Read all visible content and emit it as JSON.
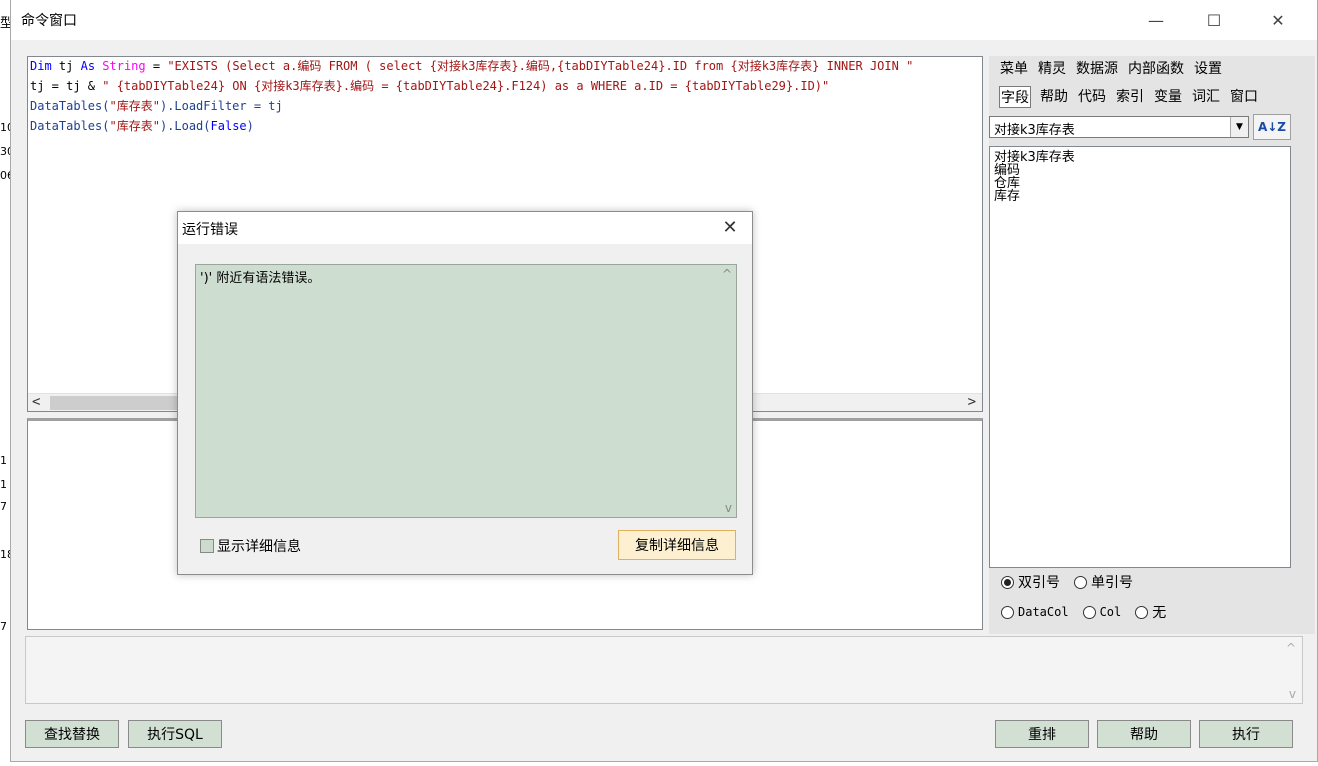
{
  "background": {
    "numbers": [
      "10",
      "30",
      "06",
      "1",
      "1",
      "7",
      "18",
      "7"
    ],
    "title_fragment": "型"
  },
  "window": {
    "title": "命令窗口",
    "minimize": "—",
    "maximize": "☐",
    "close": "✕"
  },
  "editor": {
    "line1": {
      "kw1": "Dim",
      "var1": " tj ",
      "kw2": "As",
      "sp": " ",
      "type": "String",
      "eq": " = ",
      "str": "\"EXISTS (Select a.编码 FROM ( select {对接k3库存表}.编码,{tabDIYTable24}.ID from {对接k3库存表} INNER JOIN \""
    },
    "line2": {
      "pre": "tj = tj & ",
      "str": "\" {tabDIYTable24} ON {对接k3库存表}.编码 = {tabDIYTable24}.F124) as a WHERE a.ID = {tabDIYTable29}.ID)\""
    },
    "line3": {
      "fn": "DataTables(",
      "str": "\"库存表\"",
      "post": ").LoadFilter = tj"
    },
    "line4": {
      "fn": "DataTables(",
      "str": "\"库存表\"",
      "post": ").Load(",
      "kw": "False",
      "end": ")"
    },
    "scroll_left": "<",
    "scroll_right": ">"
  },
  "right_panel": {
    "menu_row1": [
      "菜单",
      "精灵",
      "数据源",
      "内部函数",
      "设置"
    ],
    "menu_row2": [
      "字段",
      "帮助",
      "代码",
      "索引",
      "变量",
      "词汇",
      "窗口"
    ],
    "active_tab": "字段",
    "combo_value": "对接k3库存表",
    "combo_arrow": "▼",
    "sort_icon": "A↓Z",
    "fields": [
      "对接k3库存表",
      "编码",
      "仓库",
      "库存"
    ],
    "radio_row1": [
      {
        "label": "双引号",
        "checked": true
      },
      {
        "label": "单引号",
        "checked": false
      }
    ],
    "radio_row2": [
      {
        "label": "DataCol",
        "checked": false
      },
      {
        "label": "Col",
        "checked": false
      },
      {
        "label": "无",
        "checked": false
      }
    ]
  },
  "bottom": {
    "scroll_up": "^",
    "scroll_down": "v",
    "buttons_left": [
      "查找替换",
      "执行SQL"
    ],
    "buttons_right": [
      "重排",
      "帮助",
      "执行"
    ]
  },
  "dialog": {
    "title": "运行错误",
    "close": "✕",
    "message": "')' 附近有语法错误。",
    "show_details": "显示详细信息",
    "copy_details": "复制详细信息",
    "scroll_up": "^",
    "scroll_down": "v"
  },
  "colors": {
    "keyword": "#0000ff",
    "string": "#a31515",
    "type": "#ff00ff",
    "dialog_msg_bg": "#cdddd0",
    "copy_button_bg": "#fdf0d0"
  }
}
